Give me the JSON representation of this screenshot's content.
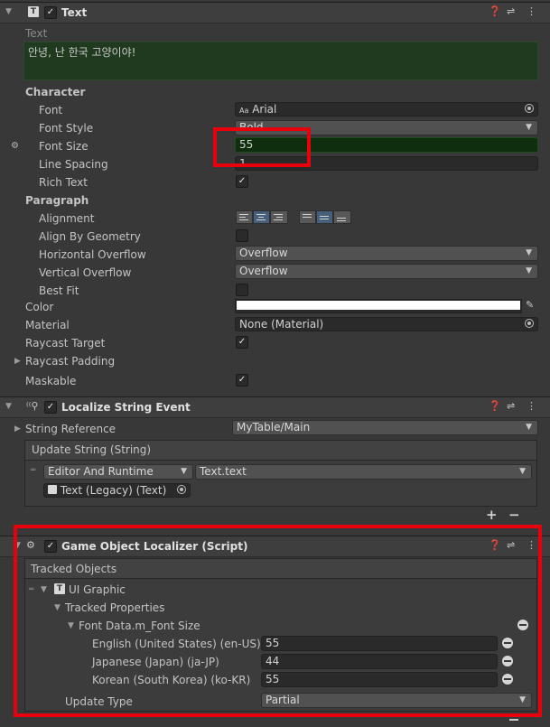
{
  "text_component": {
    "title": "Text",
    "text_label": "Text",
    "text_value": "안녕, 난 한국 고양이야!",
    "character_label": "Character",
    "font_label": "Font",
    "font_value": "Arial",
    "font_icon_text": "Aa",
    "font_style_label": "Font Style",
    "font_style_value": "Bold",
    "font_size_label": "Font Size",
    "font_size_value": "55",
    "line_spacing_label": "Line Spacing",
    "line_spacing_value": "1",
    "rich_text_label": "Rich Text",
    "paragraph_label": "Paragraph",
    "alignment_label": "Alignment",
    "align_by_geometry_label": "Align By Geometry",
    "horizontal_overflow_label": "Horizontal Overflow",
    "horizontal_overflow_value": "Overflow",
    "vertical_overflow_label": "Vertical Overflow",
    "vertical_overflow_value": "Overflow",
    "best_fit_label": "Best Fit",
    "color_label": "Color",
    "material_label": "Material",
    "material_value": "None (Material)",
    "raycast_target_label": "Raycast Target",
    "raycast_padding_label": "Raycast Padding",
    "maskable_label": "Maskable"
  },
  "localize_event": {
    "title": "Localize String Event",
    "string_reference_label": "String Reference",
    "string_reference_value": "MyTable/Main",
    "update_string_label": "Update String (String)",
    "runtime_value": "Editor And Runtime",
    "function_value": "Text.text",
    "target_value": "Text (Legacy) (Text)",
    "add_label": "+",
    "remove_label": "−"
  },
  "localizer": {
    "title": "Game Object Localizer (Script)",
    "tracked_objects_label": "Tracked Objects",
    "ui_graphic_label": "UI Graphic",
    "tracked_properties_label": "Tracked Properties",
    "font_data_label": "Font Data.m_Font Size",
    "locales": [
      {
        "label": "English (United States) (en-US)",
        "value": "55"
      },
      {
        "label": "Japanese (Japan) (ja-JP)",
        "value": "44"
      },
      {
        "label": "Korean (South Korea) (ko-KR)",
        "value": "55"
      }
    ],
    "update_type_label": "Update Type",
    "update_type_value": "Partial"
  },
  "colors": {
    "text_area_bg": "#1f3a1f",
    "font_size_bg": "#0e2e0e",
    "highlight": "#e8000c",
    "selected_alignment": "#46607c"
  }
}
